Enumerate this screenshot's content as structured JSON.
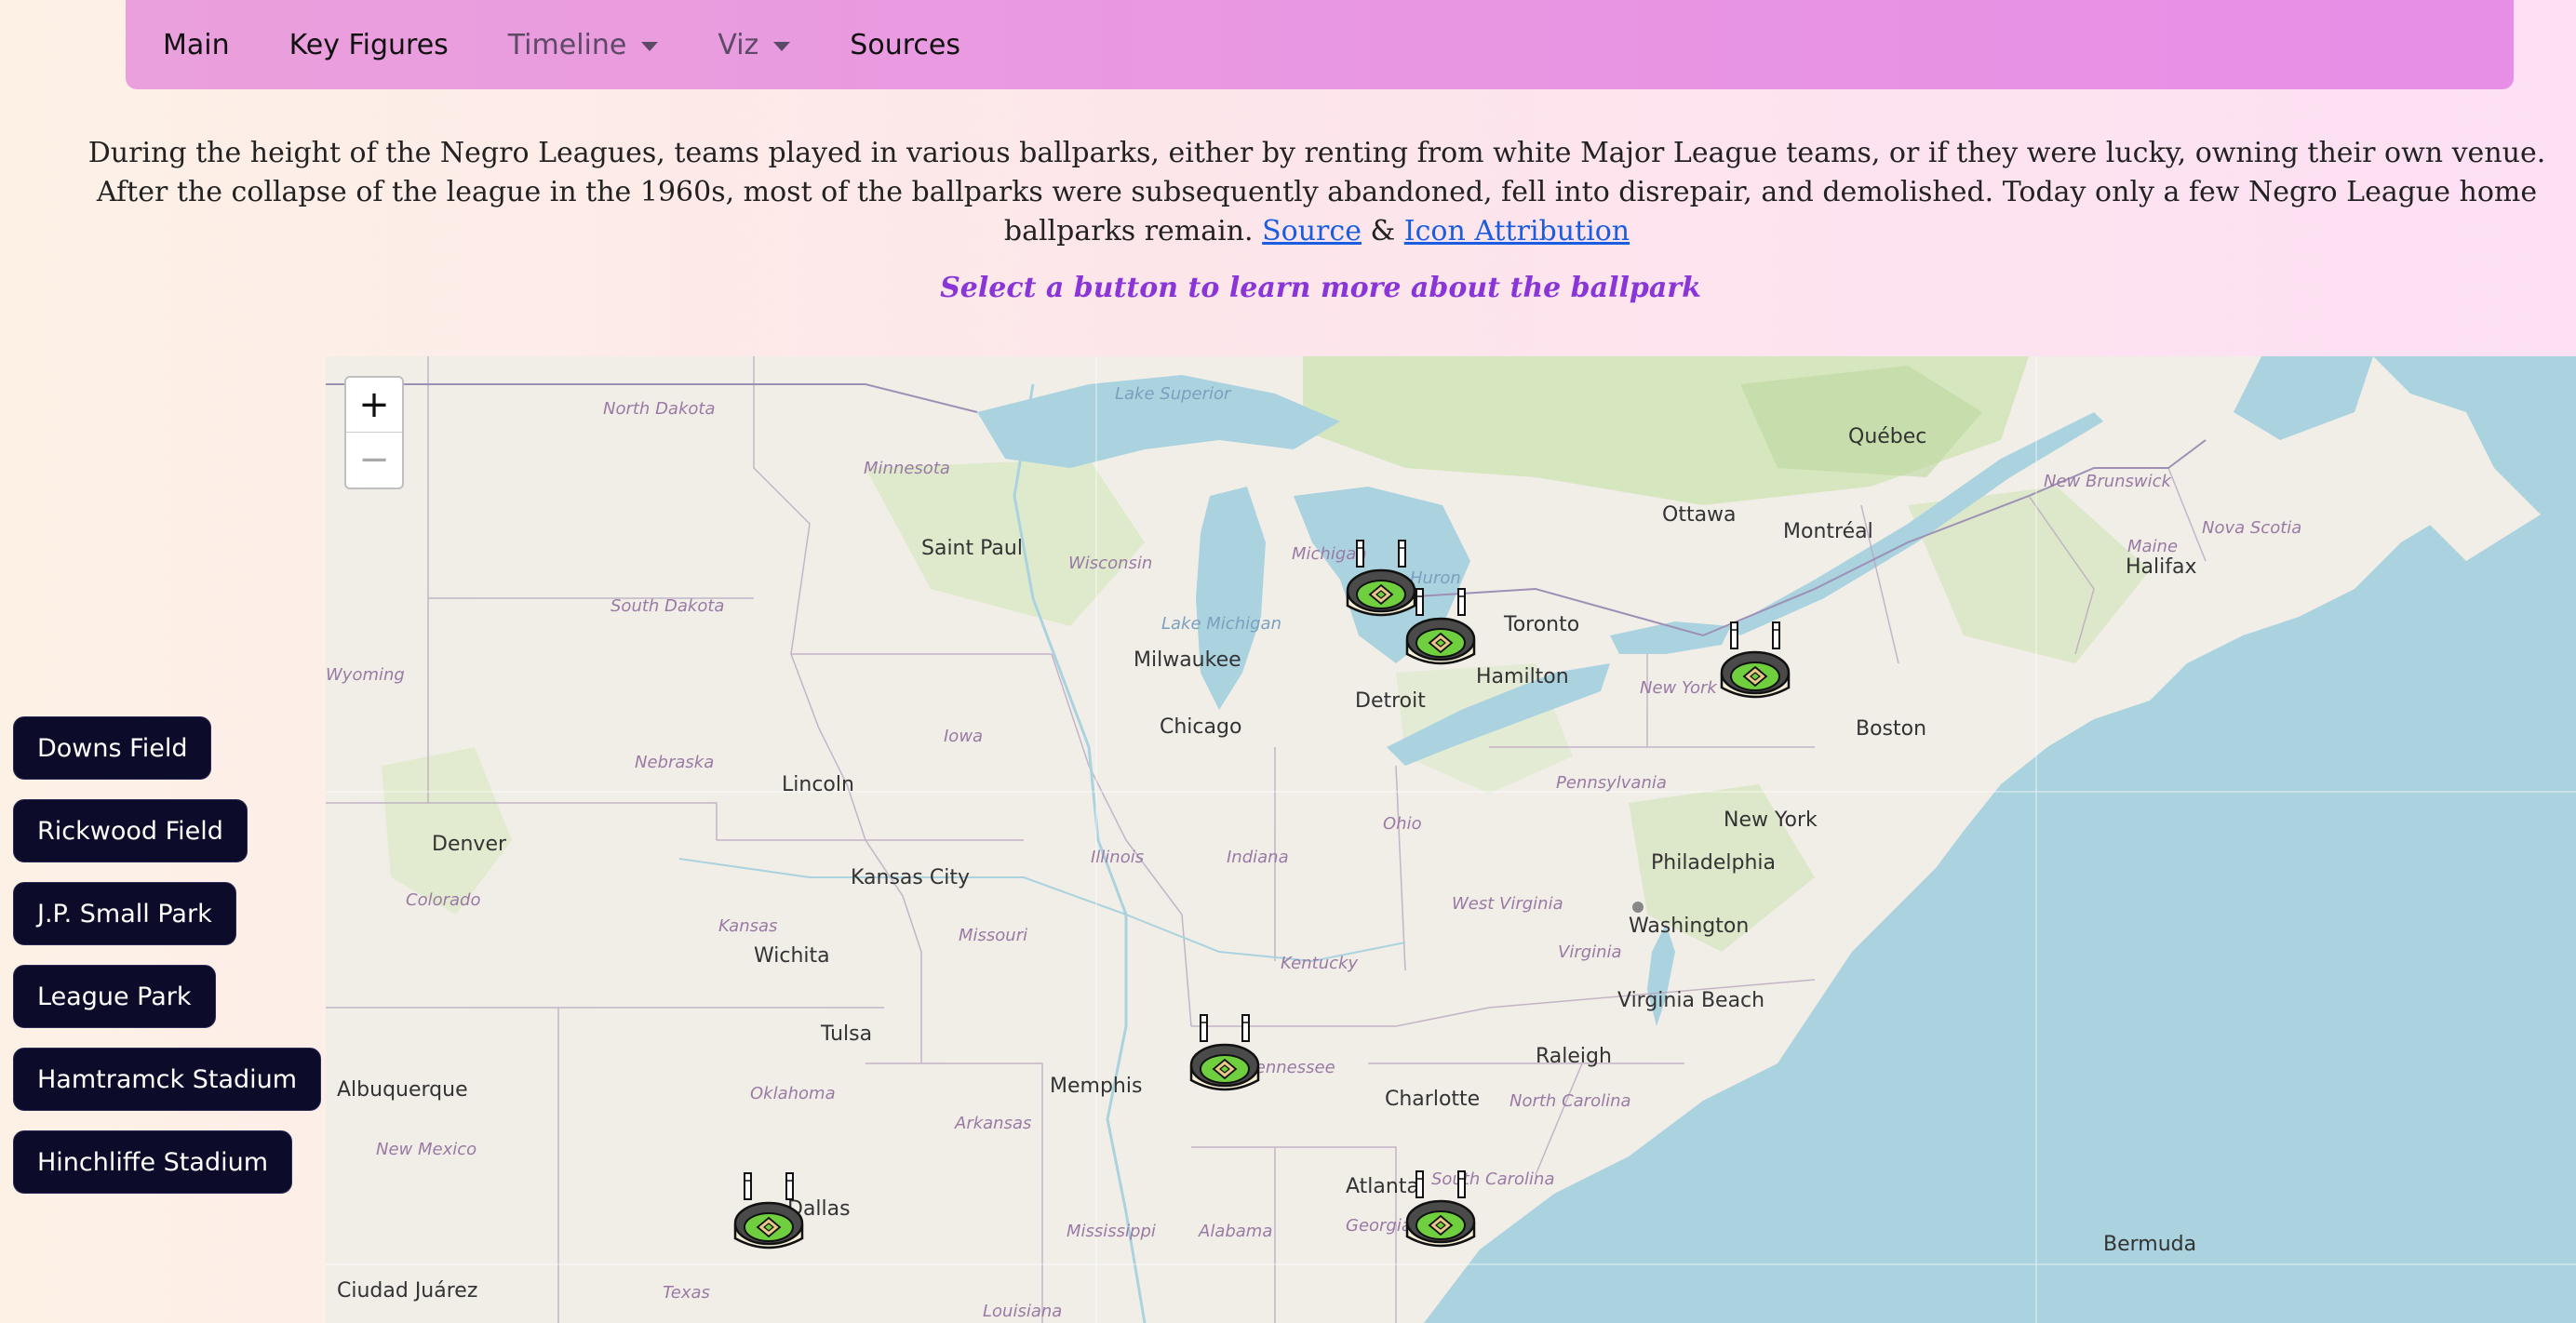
{
  "nav": {
    "main": "Main",
    "key_figures": "Key Figures",
    "timeline": "Timeline",
    "viz": "Viz",
    "sources": "Sources"
  },
  "intro": {
    "text": "During the height of the Negro Leagues, teams played in various ballparks, either by renting from white Major League teams, or if they were lucky, owning their own venue. After the collapse of the league in the 1960s, most of the ballparks were subsequently abandoned, fell into disrepair, and demolished. Today only a few Negro League home ballparks remain.",
    "source_link": "Source",
    "amp": "&",
    "icon_link": "Icon Attribution"
  },
  "prompt": "Select a button to learn more about the ballpark",
  "parks": [
    "Downs Field",
    "Rickwood Field",
    "J.P. Small Park",
    "League Park",
    "Hamtramck Stadium",
    "Hinchliffe Stadium"
  ],
  "map": {
    "zoom_in": "+",
    "zoom_out": "−",
    "cities": [
      "Saint Paul",
      "Milwaukee",
      "Chicago",
      "Detroit",
      "Toronto",
      "Hamilton",
      "Ottawa",
      "Montréal",
      "Québec",
      "Halifax",
      "Boston",
      "New York",
      "Philadelphia",
      "Washington",
      "Virginia Beach",
      "Raleigh",
      "Charlotte",
      "Atlanta",
      "Memphis",
      "Tulsa",
      "Wichita",
      "Kansas City",
      "Lincoln",
      "Denver",
      "Albuquerque",
      "Dallas",
      "Ciudad Juárez",
      "Bermuda"
    ],
    "states": [
      "North Dakota",
      "South Dakota",
      "Minnesota",
      "Wisconsin",
      "Michigan",
      "Iowa",
      "Nebraska",
      "Wyoming",
      "Colorado",
      "Kansas",
      "Missouri",
      "Illinois",
      "Indiana",
      "Ohio",
      "Pennsylvania",
      "New York",
      "West Virginia",
      "Virginia",
      "Kentucky",
      "Tennessee",
      "North Carolina",
      "South Carolina",
      "Georgia",
      "Alabama",
      "Mississippi",
      "Arkansas",
      "Oklahoma",
      "New Mexico",
      "Texas",
      "Louisiana",
      "Maine",
      "New Brunswick",
      "Nova Scotia"
    ],
    "water": [
      "Lake Superior",
      "Lake Michigan",
      "Huron"
    ],
    "colors": {
      "water": "#aad3df",
      "land": "#f1eee8",
      "forest": "#cfe3b4"
    }
  }
}
